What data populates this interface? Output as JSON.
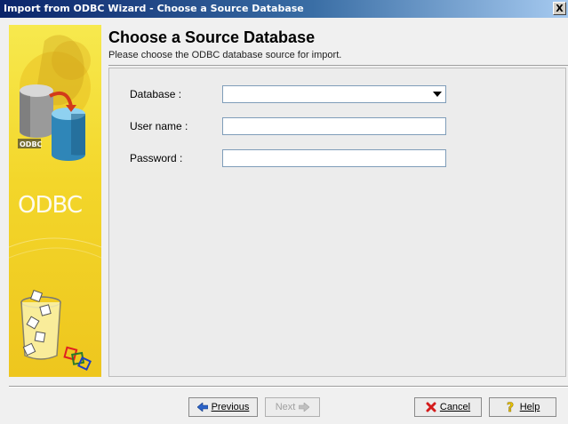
{
  "window": {
    "title": "Import from ODBC Wizard - Choose a Source Database",
    "close_label": "X"
  },
  "sidebar": {
    "logo_text": "ODBC",
    "cylinder_label": "ODBC"
  },
  "header": {
    "title": "Choose a Source Database",
    "subtitle": "Please choose the ODBC database source for import."
  },
  "form": {
    "database_label": "Database :",
    "database_value": "",
    "username_label": "User name :",
    "username_value": "",
    "password_label": "Password :",
    "password_value": ""
  },
  "buttons": {
    "previous": "Previous",
    "next": "Next",
    "cancel": "Cancel",
    "help": "Help"
  },
  "icons": {
    "previous": "arrow-left-icon",
    "next": "arrow-right-icon",
    "cancel": "red-x-icon",
    "help": "question-mark-icon",
    "dropdown": "chevron-down-icon"
  }
}
